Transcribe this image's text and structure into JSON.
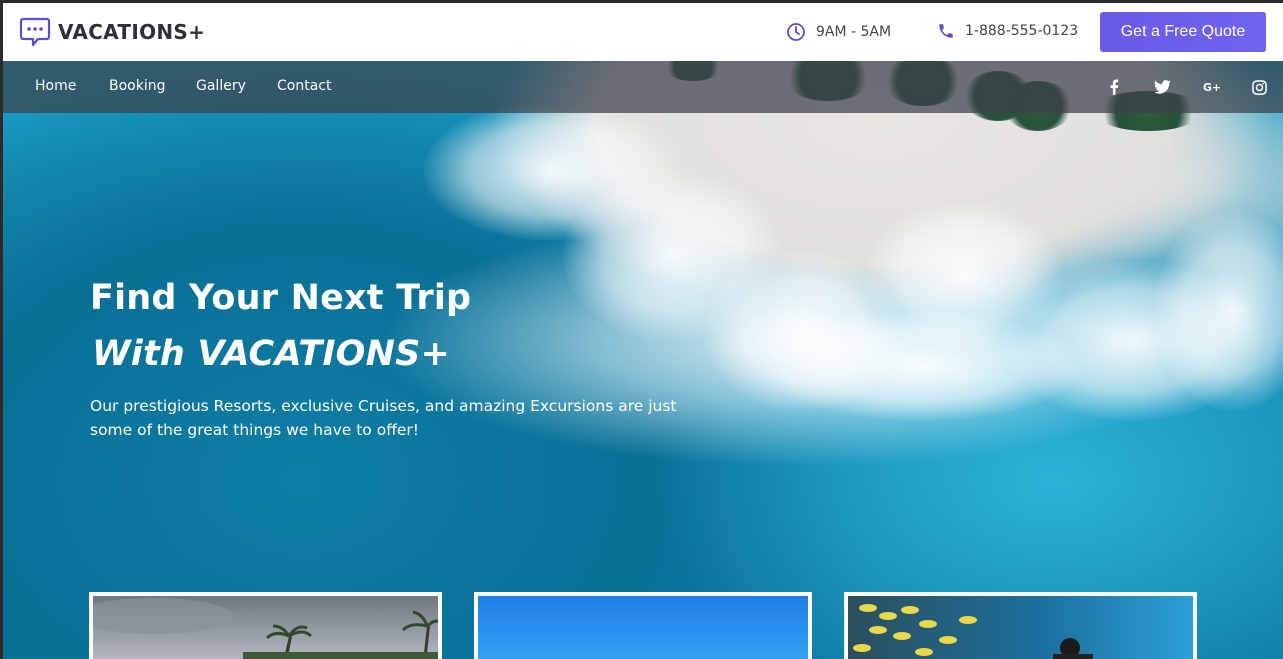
{
  "brand": {
    "name": "VACATIONS+",
    "logo_icon": "chat-bubble-icon"
  },
  "header": {
    "hours": "9AM - 5AM",
    "phone": "1-888-555-0123",
    "quote_button": "Get a Free Quote"
  },
  "nav": {
    "items": [
      {
        "label": "Home"
      },
      {
        "label": "Booking"
      },
      {
        "label": "Gallery"
      },
      {
        "label": "Contact"
      }
    ],
    "social": [
      "facebook-icon",
      "twitter-icon",
      "google-plus-icon",
      "instagram-icon"
    ]
  },
  "hero": {
    "line1": "Find Your Next Trip",
    "line2": "With VACATIONS+",
    "description": "Our prestigious Resorts, exclusive Cruises, and amazing Excursions are just some of the great things we have to offer!"
  },
  "cards": [
    {
      "name": "resort-card",
      "image": "tropical palm beach"
    },
    {
      "name": "cruise-card",
      "image": "blue sky"
    },
    {
      "name": "excursion-card",
      "image": "scuba diver with fish"
    }
  ],
  "colors": {
    "accent": "#6b5be8",
    "text_dark": "#2f2f3a",
    "nav_overlay": "#3c414b"
  }
}
